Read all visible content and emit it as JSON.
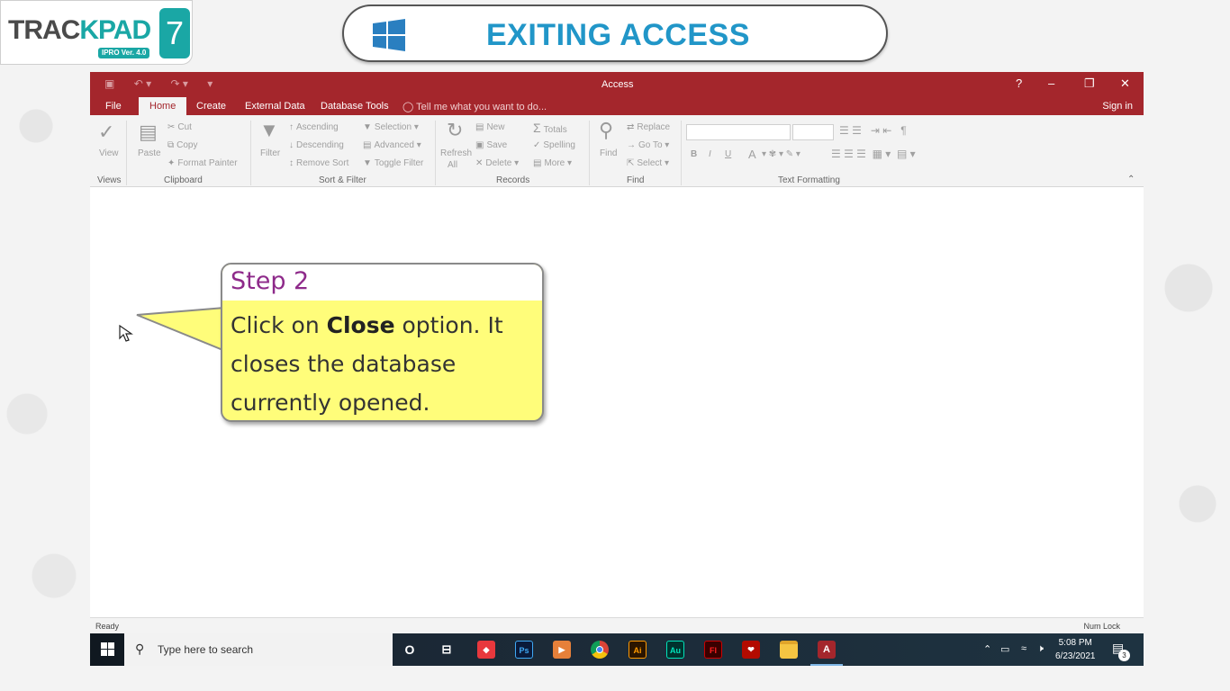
{
  "logo": {
    "brand_left": "TRAC",
    "brand_k": "K",
    "brand_right": "PAD",
    "edition": "7",
    "version": "IPRO Ver. 4.0"
  },
  "slide_title": "EXITING ACCESS",
  "window": {
    "title": "Access",
    "help": "?",
    "tabs": [
      "File",
      "Home",
      "Create",
      "External Data",
      "Database Tools"
    ],
    "tell_me": "Tell me what you want to do...",
    "sign_in": "Sign in"
  },
  "ribbon": {
    "views": {
      "view": "View",
      "group": "Views"
    },
    "clipboard": {
      "paste": "Paste",
      "cut": "Cut",
      "copy": "Copy",
      "format_painter": "Format Painter",
      "group": "Clipboard"
    },
    "sort_filter": {
      "filter": "Filter",
      "ascending": "Ascending",
      "descending": "Descending",
      "remove_sort": "Remove Sort",
      "selection": "Selection",
      "advanced": "Advanced",
      "toggle_filter": "Toggle Filter",
      "group": "Sort & Filter"
    },
    "records": {
      "refresh": "Refresh",
      "refresh_all": "All",
      "new": "New",
      "save": "Save",
      "delete": "Delete",
      "totals": "Totals",
      "spelling": "Spelling",
      "more": "More",
      "group": "Records"
    },
    "find": {
      "find": "Find",
      "replace": "Replace",
      "goto": "Go To",
      "select": "Select",
      "group": "Find"
    },
    "text_formatting": {
      "bold": "B",
      "italic": "I",
      "underline": "U",
      "font_color": "A",
      "group": "Text Formatting"
    }
  },
  "status": {
    "ready": "Ready",
    "num_lock": "Num Lock"
  },
  "taskbar": {
    "search_placeholder": "Type here to search",
    "apps": [
      {
        "name": "cortana-icon",
        "label": "O"
      },
      {
        "name": "task-view-icon",
        "label": "⊟"
      },
      {
        "name": "anydesk-icon",
        "label": "◆"
      },
      {
        "name": "photoshop-icon",
        "label": "Ps"
      },
      {
        "name": "media-player-icon",
        "label": "▶"
      },
      {
        "name": "chrome-icon",
        "label": ""
      },
      {
        "name": "illustrator-icon",
        "label": "Ai"
      },
      {
        "name": "audition-icon",
        "label": "Au"
      },
      {
        "name": "flash-icon",
        "label": "Fl"
      },
      {
        "name": "acrobat-icon",
        "label": "❤"
      },
      {
        "name": "file-explorer-icon",
        "label": ""
      },
      {
        "name": "access-icon",
        "label": "A"
      }
    ],
    "time": "5:08 PM",
    "date": "6/23/2021",
    "notification_count": "3"
  },
  "callout": {
    "heading": "Step 2",
    "text_before": "Click on ",
    "text_bold": "Close",
    "text_after_line1": " option. It",
    "line2": "closes the database",
    "line3": "currently opened."
  },
  "colors": {
    "access_red": "#a4262c",
    "callout_yellow": "#fffd7a",
    "title_blue": "#2196c8",
    "step_purple": "#8e2a8a",
    "trackpad_teal": "#1aa7a5"
  }
}
